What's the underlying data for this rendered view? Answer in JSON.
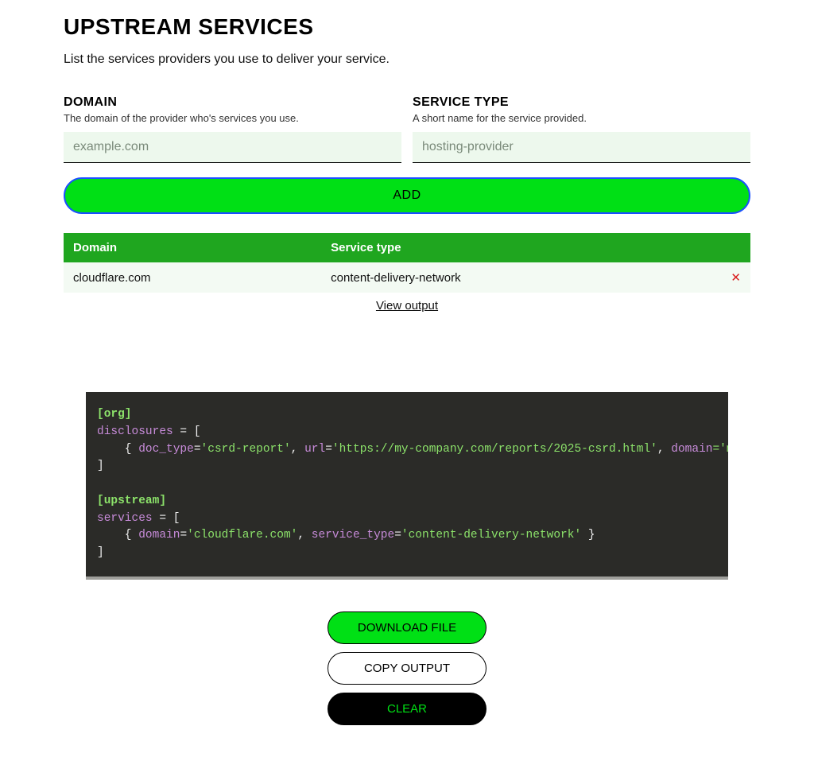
{
  "title": "UPSTREAM SERVICES",
  "subtitle": "List the services providers you use to deliver your service.",
  "form": {
    "domain": {
      "label": "DOMAIN",
      "hint": "The domain of the provider who's services you use.",
      "placeholder": "example.com"
    },
    "service_type": {
      "label": "SERVICE TYPE",
      "hint": "A short name for the service provided.",
      "placeholder": "hosting-provider"
    },
    "add_label": "ADD"
  },
  "table": {
    "headers": {
      "domain": "Domain",
      "service_type": "Service type"
    },
    "rows": [
      {
        "domain": "cloudflare.com",
        "service_type": "content-delivery-network"
      }
    ]
  },
  "view_output_label": "View output",
  "code": {
    "sec_org": "[org]",
    "disclosures_key": "disclosures",
    "eq_open": " = [",
    "close": "]",
    "disclosure_line_pre": "    { ",
    "doc_type_k": "doc_type",
    "doc_type_v": "'csrd-report'",
    "url_k": "url",
    "url_v": "'https://my-company.com/reports/2025-csrd.html'",
    "domain_k": "domain",
    "domain_trail": "='m",
    "sec_upstream": "[upstream]",
    "services_key": "services",
    "srv_domain_v": "'cloudflare.com'",
    "srv_type_k": "service_type",
    "srv_type_v": "'content-delivery-network'"
  },
  "buttons": {
    "download": "DOWNLOAD FILE",
    "copy": "COPY OUTPUT",
    "clear": "CLEAR"
  }
}
